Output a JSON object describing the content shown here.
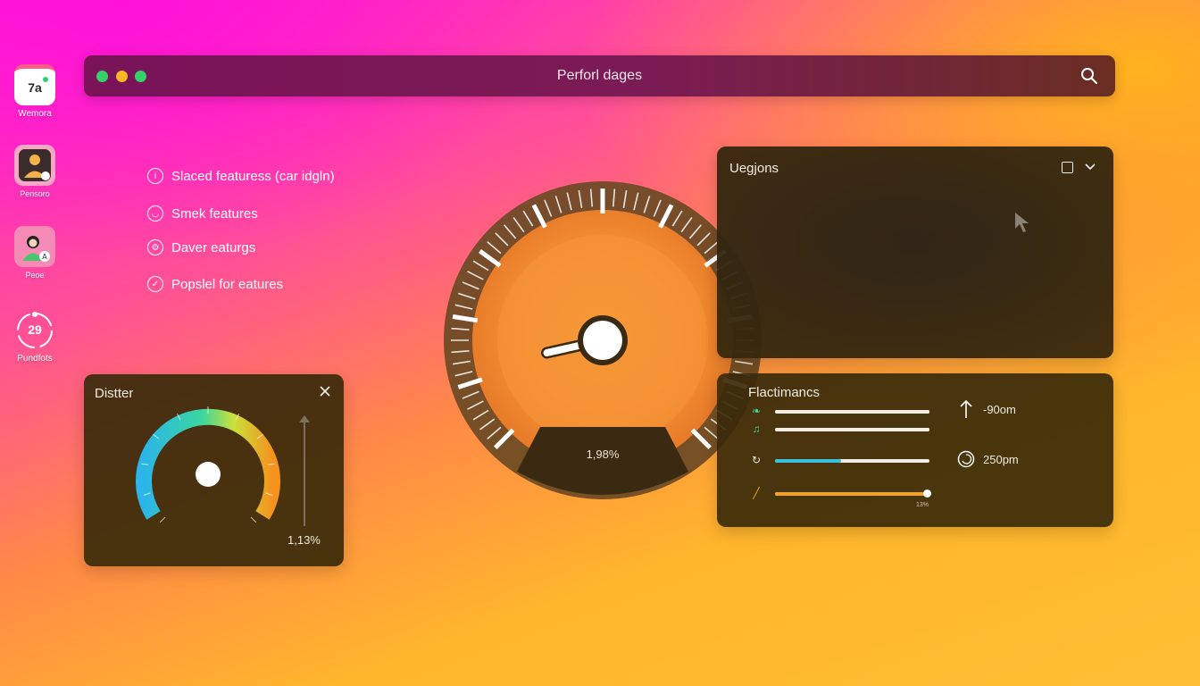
{
  "colors": {
    "traffic_green": "#35d26a",
    "traffic_yellow": "#f5b724",
    "gauge_accent": "#3cc0e0",
    "slider_accent": "#f7a21c"
  },
  "dock": [
    {
      "label": "Wemora",
      "icon": "calendar-icon",
      "badge": "7a"
    },
    {
      "label": "Pensoro",
      "icon": "profile-app-icon"
    },
    {
      "label": "Peoe",
      "icon": "people-icon"
    },
    {
      "label": "Pundfots",
      "icon": "timer-icon",
      "badge": "29"
    }
  ],
  "window": {
    "title": "Perforl dages",
    "search_icon": "search-icon"
  },
  "features": [
    {
      "label": "Slaced featuress (car idgln)",
      "icon": "info-circle-icon"
    },
    {
      "label": "Smek features",
      "icon": "smile-circle-icon"
    },
    {
      "label": "Daver eaturgs",
      "icon": "gear-circle-icon"
    },
    {
      "label": "Popslel for eatures",
      "icon": "check-circle-icon"
    }
  ],
  "distter": {
    "title": "Distter",
    "value": "1,13%",
    "level": 0.55
  },
  "main_gauge": {
    "value": "1,98%",
    "level": 0.12
  },
  "regions": {
    "title": "Uegjons"
  },
  "performance": {
    "title": "Flactimancs",
    "metrics": [
      {
        "icon": "leaf-icon",
        "level": 1.0,
        "color": "#f1eee8"
      },
      {
        "icon": "music-note-icon",
        "level": 1.0,
        "color": "#f1eee8"
      },
      {
        "icon": "refresh-icon",
        "level": 0.43,
        "color": "#3cc0e0"
      },
      {
        "icon": "edit-icon",
        "level": 0.97,
        "color": "#f7a21c",
        "label": "13%"
      }
    ],
    "stats": [
      {
        "icon": "arrow-up-icon",
        "value": "-90om"
      },
      {
        "icon": "clock-spiral-icon",
        "value": "250pm"
      }
    ]
  }
}
